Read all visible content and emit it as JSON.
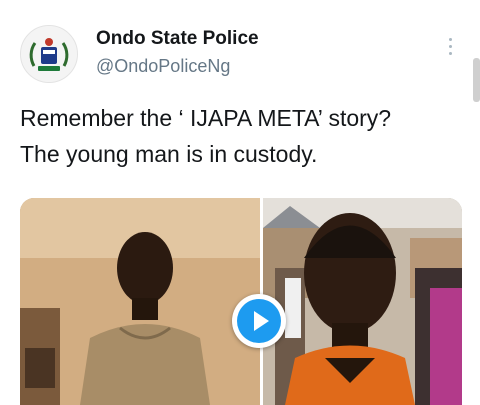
{
  "account": {
    "name": "Ondo State Police",
    "handle": "@OndoPoliceNg",
    "avatar_icon": "police-crest-icon"
  },
  "tweet": {
    "lines": [
      "Remember the  ‘ IJAPA META’ story?",
      "The young man is in custody."
    ]
  },
  "media": {
    "type": "video",
    "play_icon": "play-icon",
    "accent_color": "#1d9bf0"
  },
  "menu_icon": "more-vertical-icon"
}
